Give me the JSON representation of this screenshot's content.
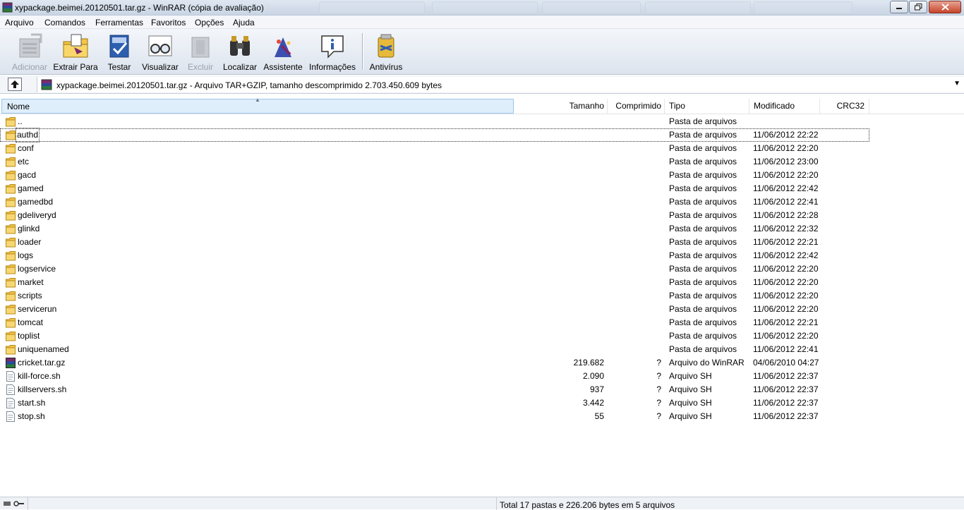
{
  "window": {
    "title": "xypackage.beimei.20120501.tar.gz - WinRAR (cópia de avaliação)"
  },
  "menu": [
    "Arquivo",
    "Comandos",
    "Ferramentas",
    "Favoritos",
    "Opções",
    "Ajuda"
  ],
  "toolbar": {
    "add": "Adicionar",
    "extract": "Extrair Para",
    "test": "Testar",
    "view": "Visualizar",
    "delete": "Excluir",
    "find": "Localizar",
    "wizard": "Assistente",
    "info": "Informações",
    "antivirus": "Antivírus"
  },
  "pathbar": {
    "text": "xypackage.beimei.20120501.tar.gz - Arquivo TAR+GZIP, tamanho descomprimido 2.703.450.609 bytes"
  },
  "columns": {
    "name": "Nome",
    "size": "Tamanho",
    "packed": "Comprimido",
    "type": "Tipo",
    "modified": "Modificado",
    "crc": "CRC32"
  },
  "rows": [
    {
      "icon": "folder-icon",
      "name": "..",
      "size": "",
      "packed": "",
      "type": "Pasta de arquivos",
      "modified": ""
    },
    {
      "icon": "folder-icon",
      "name": "authd",
      "size": "",
      "packed": "",
      "type": "Pasta de arquivos",
      "modified": "11/06/2012 22:22"
    },
    {
      "icon": "folder-icon",
      "name": "conf",
      "size": "",
      "packed": "",
      "type": "Pasta de arquivos",
      "modified": "11/06/2012 22:20"
    },
    {
      "icon": "folder-icon",
      "name": "etc",
      "size": "",
      "packed": "",
      "type": "Pasta de arquivos",
      "modified": "11/06/2012 23:00"
    },
    {
      "icon": "folder-icon",
      "name": "gacd",
      "size": "",
      "packed": "",
      "type": "Pasta de arquivos",
      "modified": "11/06/2012 22:20"
    },
    {
      "icon": "folder-icon",
      "name": "gamed",
      "size": "",
      "packed": "",
      "type": "Pasta de arquivos",
      "modified": "11/06/2012 22:42"
    },
    {
      "icon": "folder-icon",
      "name": "gamedbd",
      "size": "",
      "packed": "",
      "type": "Pasta de arquivos",
      "modified": "11/06/2012 22:41"
    },
    {
      "icon": "folder-icon",
      "name": "gdeliveryd",
      "size": "",
      "packed": "",
      "type": "Pasta de arquivos",
      "modified": "11/06/2012 22:28"
    },
    {
      "icon": "folder-icon",
      "name": "glinkd",
      "size": "",
      "packed": "",
      "type": "Pasta de arquivos",
      "modified": "11/06/2012 22:32"
    },
    {
      "icon": "folder-icon",
      "name": "loader",
      "size": "",
      "packed": "",
      "type": "Pasta de arquivos",
      "modified": "11/06/2012 22:21"
    },
    {
      "icon": "folder-icon",
      "name": "logs",
      "size": "",
      "packed": "",
      "type": "Pasta de arquivos",
      "modified": "11/06/2012 22:42"
    },
    {
      "icon": "folder-icon",
      "name": "logservice",
      "size": "",
      "packed": "",
      "type": "Pasta de arquivos",
      "modified": "11/06/2012 22:20"
    },
    {
      "icon": "folder-icon",
      "name": "market",
      "size": "",
      "packed": "",
      "type": "Pasta de arquivos",
      "modified": "11/06/2012 22:20"
    },
    {
      "icon": "folder-icon",
      "name": "scripts",
      "size": "",
      "packed": "",
      "type": "Pasta de arquivos",
      "modified": "11/06/2012 22:20"
    },
    {
      "icon": "folder-icon",
      "name": "servicerun",
      "size": "",
      "packed": "",
      "type": "Pasta de arquivos",
      "modified": "11/06/2012 22:20"
    },
    {
      "icon": "folder-icon",
      "name": "tomcat",
      "size": "",
      "packed": "",
      "type": "Pasta de arquivos",
      "modified": "11/06/2012 22:21"
    },
    {
      "icon": "folder-icon",
      "name": "toplist",
      "size": "",
      "packed": "",
      "type": "Pasta de arquivos",
      "modified": "11/06/2012 22:20"
    },
    {
      "icon": "folder-icon",
      "name": "uniquenamed",
      "size": "",
      "packed": "",
      "type": "Pasta de arquivos",
      "modified": "11/06/2012 22:41"
    },
    {
      "icon": "winrar-archive-icon",
      "name": "cricket.tar.gz",
      "size": "219.682",
      "packed": "?",
      "type": "Arquivo do WinRAR",
      "modified": "04/06/2010 04:27"
    },
    {
      "icon": "script-file-icon",
      "name": "kill-force.sh",
      "size": "2.090",
      "packed": "?",
      "type": "Arquivo SH",
      "modified": "11/06/2012 22:37"
    },
    {
      "icon": "script-file-icon",
      "name": "killservers.sh",
      "size": "937",
      "packed": "?",
      "type": "Arquivo SH",
      "modified": "11/06/2012 22:37"
    },
    {
      "icon": "script-file-icon",
      "name": "start.sh",
      "size": "3.442",
      "packed": "?",
      "type": "Arquivo SH",
      "modified": "11/06/2012 22:37"
    },
    {
      "icon": "script-file-icon",
      "name": "stop.sh",
      "size": "55",
      "packed": "?",
      "type": "Arquivo SH",
      "modified": "11/06/2012 22:37"
    }
  ],
  "status": {
    "summary": "Total 17 pastas e 226.206 bytes em 5 arquivos"
  }
}
